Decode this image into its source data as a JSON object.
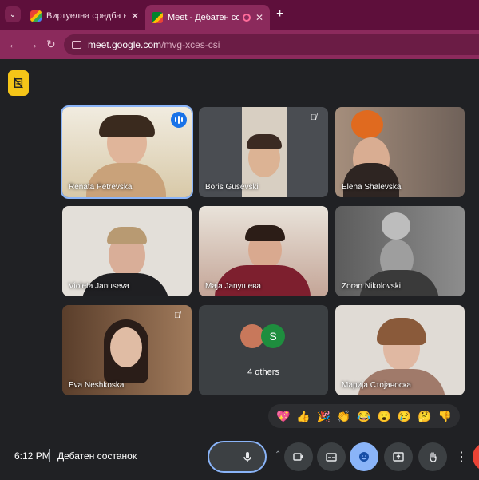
{
  "browser": {
    "tabs": [
      {
        "title": "Виртуелна средба на дебатни",
        "favicon": "gmail-favicon"
      },
      {
        "title": "Meet - Дебатен состанок",
        "favicon": "meet-favicon",
        "active": true
      }
    ],
    "url": {
      "host": "meet.google.com",
      "path": "/mvg-xces-csi"
    }
  },
  "participants": [
    {
      "name": "Renata Petrevska",
      "speaking": true,
      "bg": "#e7dcc4"
    },
    {
      "name": "Boris Gusevski",
      "muted": true,
      "bg": "#5a5e63"
    },
    {
      "name": "Elena Shalevska",
      "bg": "#8c7a6e"
    },
    {
      "name": "Violeta Januseva",
      "bg": "#d7d2cc"
    },
    {
      "name": "Maja Janушева",
      "bg": "#b3443f"
    },
    {
      "name": "Zoran Nikolovski",
      "bg": "#6a6a6a"
    },
    {
      "name": "Eva Neshkoska",
      "muted": true,
      "bg": "#7a5842"
    },
    {
      "name": "Марија Стојаноска",
      "bg": "#d9d4cf"
    }
  ],
  "others_tile": {
    "label": "4 others",
    "avatar_letter": "S"
  },
  "reactions": [
    "💖",
    "👍",
    "🎉",
    "👏",
    "😂",
    "😮",
    "😢",
    "🤔",
    "👎"
  ],
  "bottom_bar": {
    "time": "6:12 PM",
    "meeting_title": "Дебатен состанок"
  },
  "colors": {
    "tabbar": "#5e0f3b",
    "toolbar": "#8b2a5c",
    "meet_bg": "#202124",
    "accent": "#8ab4f8"
  }
}
